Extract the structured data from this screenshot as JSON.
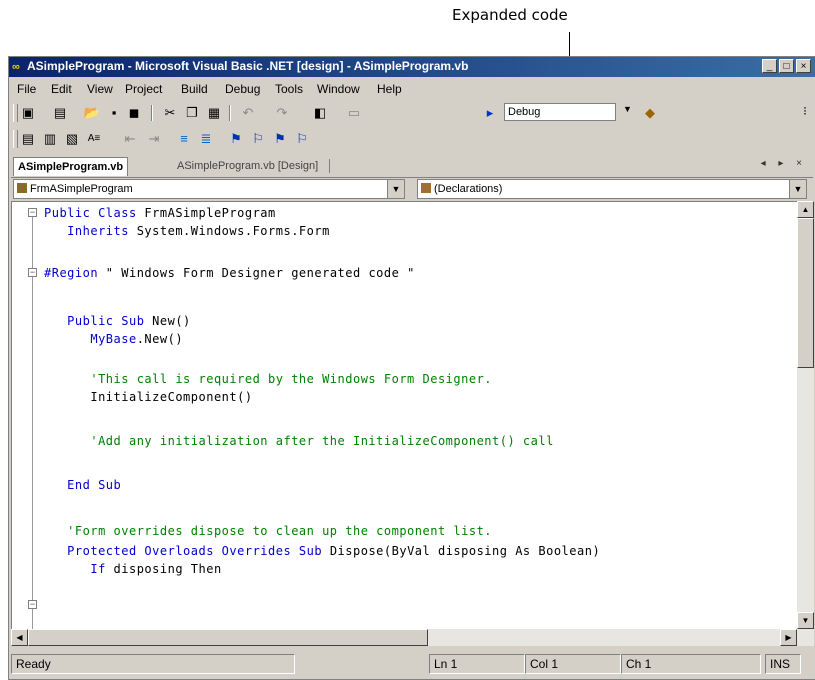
{
  "callout": {
    "label": "Expanded code"
  },
  "window": {
    "title": "ASimpleProgram - Microsoft Visual Basic .NET [design] - ASimpleProgram.vb",
    "controls": [
      "_",
      "□",
      "×"
    ]
  },
  "menu": [
    "File",
    "Edit",
    "View",
    "Project",
    "Build",
    "Debug",
    "Tools",
    "Window",
    "Help"
  ],
  "toolbar": {
    "configuration": "Debug"
  },
  "tabs": {
    "active": "ASimpleProgram.vb",
    "inactive": "ASimpleProgram.vb [Design]",
    "nav": "◂ ▸ ×"
  },
  "dropdowns": {
    "class_name": "FrmASimpleProgram",
    "method_name": "(Declarations)"
  },
  "code_lines": [
    {
      "kw": "Public Class",
      "text": " FrmASimpleProgram",
      "cm": ""
    },
    {
      "kw": "   Inherits",
      "text": " System.Windows.Forms.Form",
      "cm": ""
    },
    {
      "kw": "#Region",
      "text": " \" Windows Form Designer generated code \"",
      "cm": ""
    },
    {
      "kw": "   Public Sub",
      "text": " New()",
      "cm": ""
    },
    {
      "kw": "      MyBase",
      "text": ".New()",
      "cm": ""
    },
    {
      "kw": "",
      "text": "",
      "cm": "      'This call is required by the Windows Form Designer."
    },
    {
      "kw": "",
      "text": "      InitializeComponent()",
      "cm": ""
    },
    {
      "kw": "",
      "text": "",
      "cm": "      'Add any initialization after the InitializeComponent() call"
    },
    {
      "kw": "   End Sub",
      "text": "",
      "cm": ""
    },
    {
      "kw": "",
      "text": "",
      "cm": "   'Form overrides dispose to clean up the component list."
    },
    {
      "kw": "   Protected Overloads Overrides Sub",
      "text": " Dispose(ByVal disposing As Boolean)",
      "cm": ""
    },
    {
      "kw": "      If",
      "text": " disposing Then",
      "cm": ""
    }
  ],
  "status": {
    "ready": "Ready",
    "line": "Ln 1",
    "col": "Col 1",
    "ch": "Ch 1",
    "mode": "INS"
  }
}
